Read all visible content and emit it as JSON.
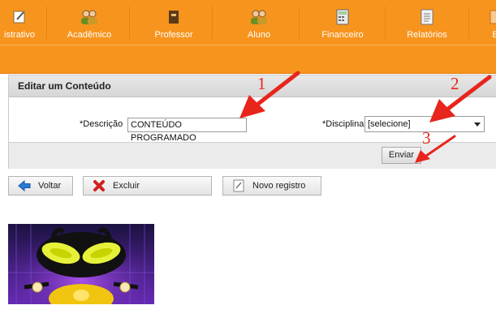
{
  "nav": {
    "items": [
      {
        "label": "istrativo",
        "icon": "notepad-icon"
      },
      {
        "label": "Acadêmico",
        "icon": "users-icon"
      },
      {
        "label": "Professor",
        "icon": "book-icon"
      },
      {
        "label": "Aluno",
        "icon": "users-icon"
      },
      {
        "label": "Financeiro",
        "icon": "calculator-icon"
      },
      {
        "label": "Relatórios",
        "icon": "report-icon"
      },
      {
        "label": "E",
        "icon": "generic-icon"
      }
    ],
    "bar_color": "#f7941d"
  },
  "panel": {
    "title": "Editar um Conteúdo",
    "descricao_label": "*Descrição",
    "descricao_value": "CONTEÚDO PROGRAMADO",
    "disciplina_label": "*Disciplina",
    "disciplina_value": "[selecione]",
    "submit_label": "Enviar"
  },
  "actions": {
    "voltar": "Voltar",
    "excluir": "Excluir",
    "novo": "Novo registro"
  },
  "annotations": {
    "one": "1",
    "two": "2",
    "three": "3",
    "color": "#e8251c"
  },
  "image": {
    "icon": "robot-mascot-image"
  }
}
